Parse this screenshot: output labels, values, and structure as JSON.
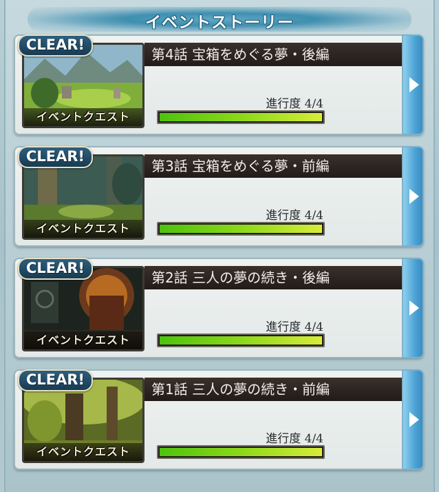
{
  "header": {
    "title": "イベントストーリー"
  },
  "episodes": [
    {
      "badge": "CLEAR!",
      "thumb_label": "イベントクエスト",
      "title": "第4話 宝箱をめぐる夢・後編",
      "progress_label": "進行度 4/4",
      "progress_fraction": 1.0,
      "thumb_theme": "meadow"
    },
    {
      "badge": "CLEAR!",
      "thumb_label": "イベントクエスト",
      "title": "第3話 宝箱をめぐる夢・前編",
      "progress_label": "進行度 4/4",
      "progress_fraction": 1.0,
      "thumb_theme": "forest"
    },
    {
      "badge": "CLEAR!",
      "thumb_label": "イベントクエスト",
      "title": "第2話 三人の夢の続き・後編",
      "progress_label": "進行度 4/4",
      "progress_fraction": 1.0,
      "thumb_theme": "ruins"
    },
    {
      "badge": "CLEAR!",
      "thumb_label": "イベントクエスト",
      "title": "第1話 三人の夢の続き・前編",
      "progress_label": "進行度 4/4",
      "progress_fraction": 1.0,
      "thumb_theme": "woods"
    }
  ],
  "colors": {
    "accent": "#3f8fb0",
    "progress_start": "#4ec20e",
    "progress_end": "#d6ec3a",
    "title_bar": "#2a221e"
  },
  "icons": {
    "next": "triangle-right-icon"
  }
}
